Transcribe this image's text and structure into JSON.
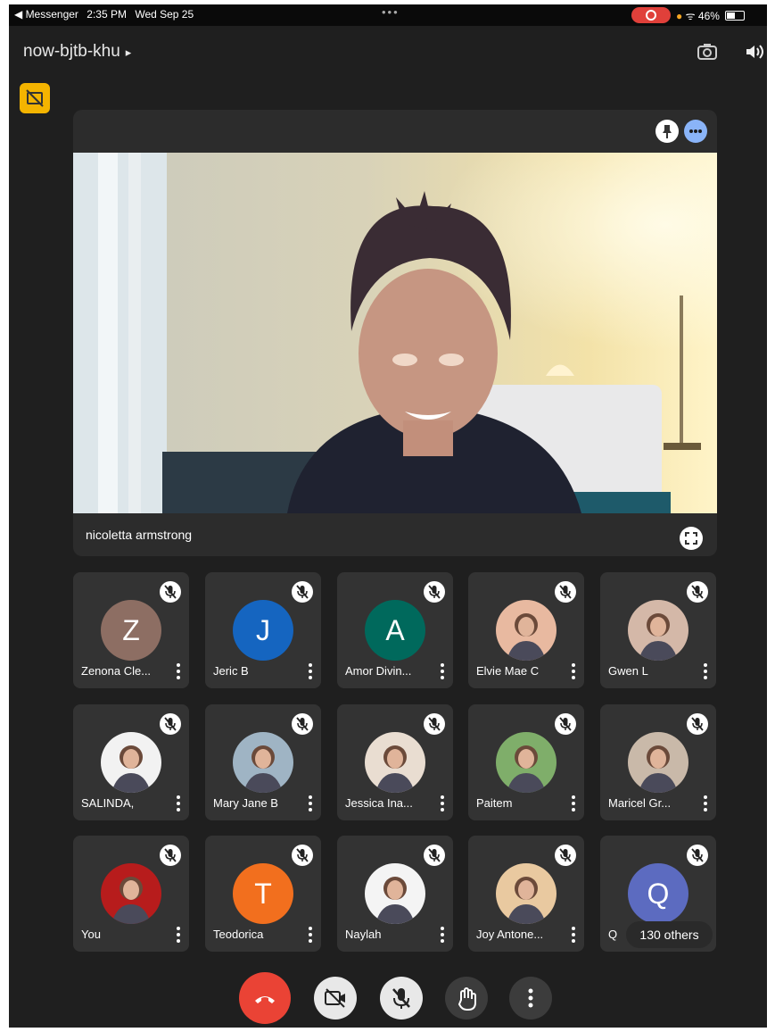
{
  "status_bar": {
    "back_app": "◀ Messenger",
    "time": "2:35 PM",
    "date": "Wed Sep 25",
    "battery": "46%",
    "dots": "•••"
  },
  "header": {
    "meeting_code": "now-bjtb-khu",
    "caret": "▸"
  },
  "main_tile": {
    "name": "nicoletta armstrong"
  },
  "participants": [
    {
      "name": "Zenona Cle...",
      "initial": "Z",
      "color": "#8d6e63"
    },
    {
      "name": "Jeric B",
      "initial": "J",
      "color": "#1565c0"
    },
    {
      "name": "Amor Divin...",
      "initial": "A",
      "color": "#00695c"
    },
    {
      "name": "Elvie Mae C",
      "initial": "",
      "color": "#e8b9a0"
    },
    {
      "name": "Gwen L",
      "initial": "",
      "color": "#d4b8a8"
    },
    {
      "name": "SALINDA,",
      "initial": "",
      "color": "#f2f2f2"
    },
    {
      "name": "Mary Jane B",
      "initial": "",
      "color": "#9fb4c4"
    },
    {
      "name": "Jessica Ina...",
      "initial": "",
      "color": "#e9ddd1"
    },
    {
      "name": "Paitem",
      "initial": "",
      "color": "#7fae6a"
    },
    {
      "name": "Maricel Gr...",
      "initial": "",
      "color": "#c9b9a9"
    },
    {
      "name": "You",
      "initial": "",
      "color": "#b71c1c"
    },
    {
      "name": "Teodorica",
      "initial": "T",
      "color": "#f26f1e"
    },
    {
      "name": "Naylah",
      "initial": "",
      "color": "#f4f4f4"
    },
    {
      "name": "Joy Antone...",
      "initial": "",
      "color": "#e9c9a0"
    },
    {
      "name": "Q",
      "initial": "Q",
      "color": "#5c6bc0"
    }
  ],
  "others_count": "130 others",
  "icons": {
    "mute": "mic-off-icon",
    "end_call": "phone-hangup-icon",
    "video": "video-off-icon",
    "mic": "mic-off-icon",
    "hand": "raise-hand-icon",
    "more": "more-vert-icon",
    "camera_switch": "camera-switch-icon",
    "speaker": "speaker-icon"
  }
}
